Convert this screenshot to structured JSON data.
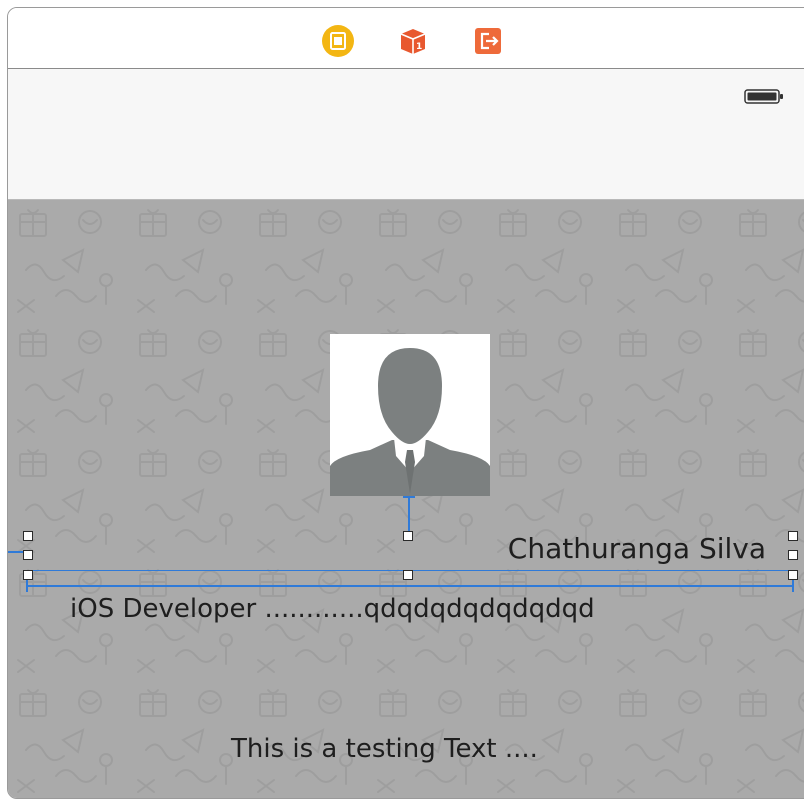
{
  "dock": {
    "icons": [
      {
        "name": "view-controller-icon",
        "color": "#f3b613"
      },
      {
        "name": "first-responder-icon",
        "color": "#e8582f"
      },
      {
        "name": "exit-icon",
        "color": "#ee6a3a"
      }
    ]
  },
  "status_bar": {
    "battery_icon": "battery-full-icon"
  },
  "content": {
    "background_color": "#aaaaaa",
    "profile_image": "person-silhouette",
    "name_label": "Chathuranga Silva",
    "role_label": "iOS Developer ............qdqdqdqdqdqdqd",
    "test_label": "This is a testing Text ...."
  },
  "colors": {
    "constraint": "#2f7ad8",
    "selection_handle_fill": "#ffffff"
  }
}
